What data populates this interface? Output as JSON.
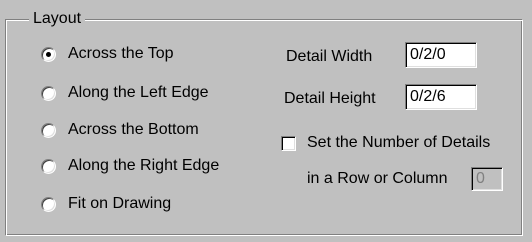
{
  "group": {
    "title": "Layout"
  },
  "radios": [
    {
      "label": "Across the Top",
      "selected": true
    },
    {
      "label": "Along the Left Edge",
      "selected": false
    },
    {
      "label": "Across the Bottom",
      "selected": false
    },
    {
      "label": "Along the Right Edge",
      "selected": false
    },
    {
      "label": "Fit on Drawing",
      "selected": false
    }
  ],
  "detail_width": {
    "label": "Detail Width",
    "value": "0/2/0"
  },
  "detail_height": {
    "label": "Detail Height",
    "value": "0/2/6"
  },
  "set_number": {
    "line1": "Set the Number of Details",
    "line2": "in a Row or Column",
    "checked": false,
    "value": "0"
  }
}
